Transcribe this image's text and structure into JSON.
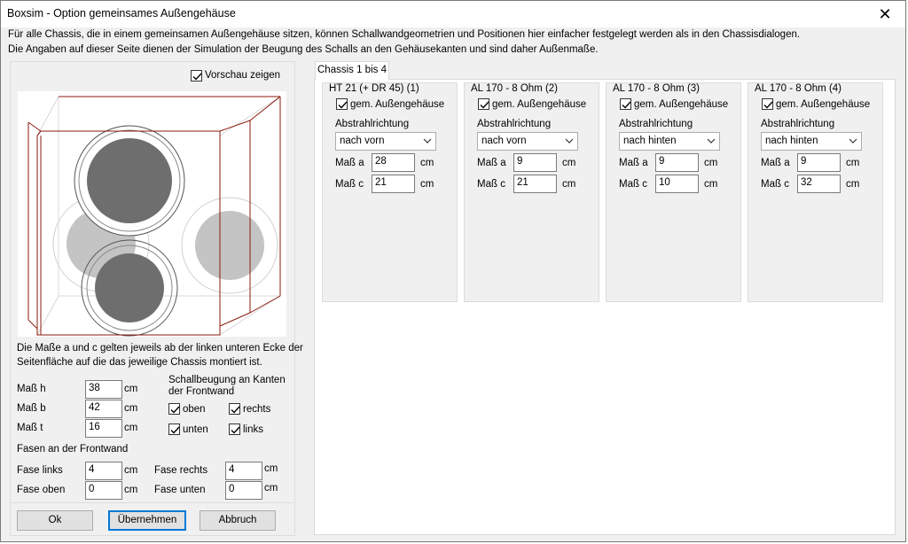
{
  "window": {
    "title": "Boxsim - Option gemeinsames Außengehäuse",
    "close_icon": "close-icon"
  },
  "intro": {
    "line1": "Für alle Chassis, die in einem gemeinsamen Außengehäuse sitzen, können Schallwandgeometrien und Positionen hier einfacher festgelegt werden als in den Chassisdialogen.",
    "line2": "Die Angaben auf dieser Seite dienen der Simulation der  Beugung des Schalls an den Gehäusekanten und sind daher Außenmaße."
  },
  "preview": {
    "label": "Vorschau zeigen",
    "checked": true
  },
  "note": {
    "line1": "Die Maße a und c gelten jeweils ab der linken unteren Ecke der",
    "line2": "Seitenfläche auf die das jeweilige Chassis montiert ist."
  },
  "dimensions": {
    "h_label": "Maß h",
    "h_value": "38",
    "b_label": "Maß b",
    "b_value": "42",
    "t_label": "Maß t",
    "t_value": "16",
    "unit": "cm"
  },
  "diffraction": {
    "heading1": "Schallbeugung an Kanten",
    "heading2": "der Frontwand",
    "oben": "oben",
    "rechts": "rechts",
    "unten": "unten",
    "links": "links"
  },
  "chamfers": {
    "heading": "Fasen an der Frontwand",
    "left_label": "Fase links",
    "left_value": "4",
    "right_label": "Fase rechts",
    "right_value": "4",
    "top_label": "Fase oben",
    "top_value": "0",
    "bottom_label": "Fase unten",
    "bottom_value": "0",
    "unit": "cm"
  },
  "buttons": {
    "ok": "Ok",
    "apply": "Übernehmen",
    "cancel": "Abbruch"
  },
  "tabs": [
    {
      "label": "Chassis 1 bis 4",
      "active": true
    }
  ],
  "chassis": [
    {
      "name": "HT 21 (+ DR 45) (1)",
      "shared": "gem. Außengehäuse",
      "direction_label": "Abstrahlrichtung",
      "direction": "nach vorn",
      "a_label": "Maß a",
      "a": "28",
      "c_label": "Maß c",
      "c": "21",
      "unit": "cm"
    },
    {
      "name": "AL 170 - 8 Ohm (2)",
      "shared": "gem. Außengehäuse",
      "direction_label": "Abstrahlrichtung",
      "direction": "nach vorn",
      "a_label": "Maß a",
      "a": "9",
      "c_label": "Maß c",
      "c": "21",
      "unit": "cm"
    },
    {
      "name": "AL 170 - 8 Ohm (3)",
      "shared": "gem. Außengehäuse",
      "direction_label": "Abstrahlrichtung",
      "direction": "nach hinten",
      "a_label": "Maß a",
      "a": "9",
      "c_label": "Maß c",
      "c": "10",
      "unit": "cm"
    },
    {
      "name": "AL 170 - 8 Ohm (4)",
      "shared": "gem. Außengehäuse",
      "direction_label": "Abstrahlrichtung",
      "direction": "nach hinten",
      "a_label": "Maß a",
      "a": "9",
      "c_label": "Maß c",
      "c": "32",
      "unit": "cm"
    }
  ],
  "colors": {
    "box_edge": "#8b1a0c",
    "driver_front": "#6e6e6e",
    "driver_rear": "#c4c4c4",
    "accent": "#0078d7"
  }
}
